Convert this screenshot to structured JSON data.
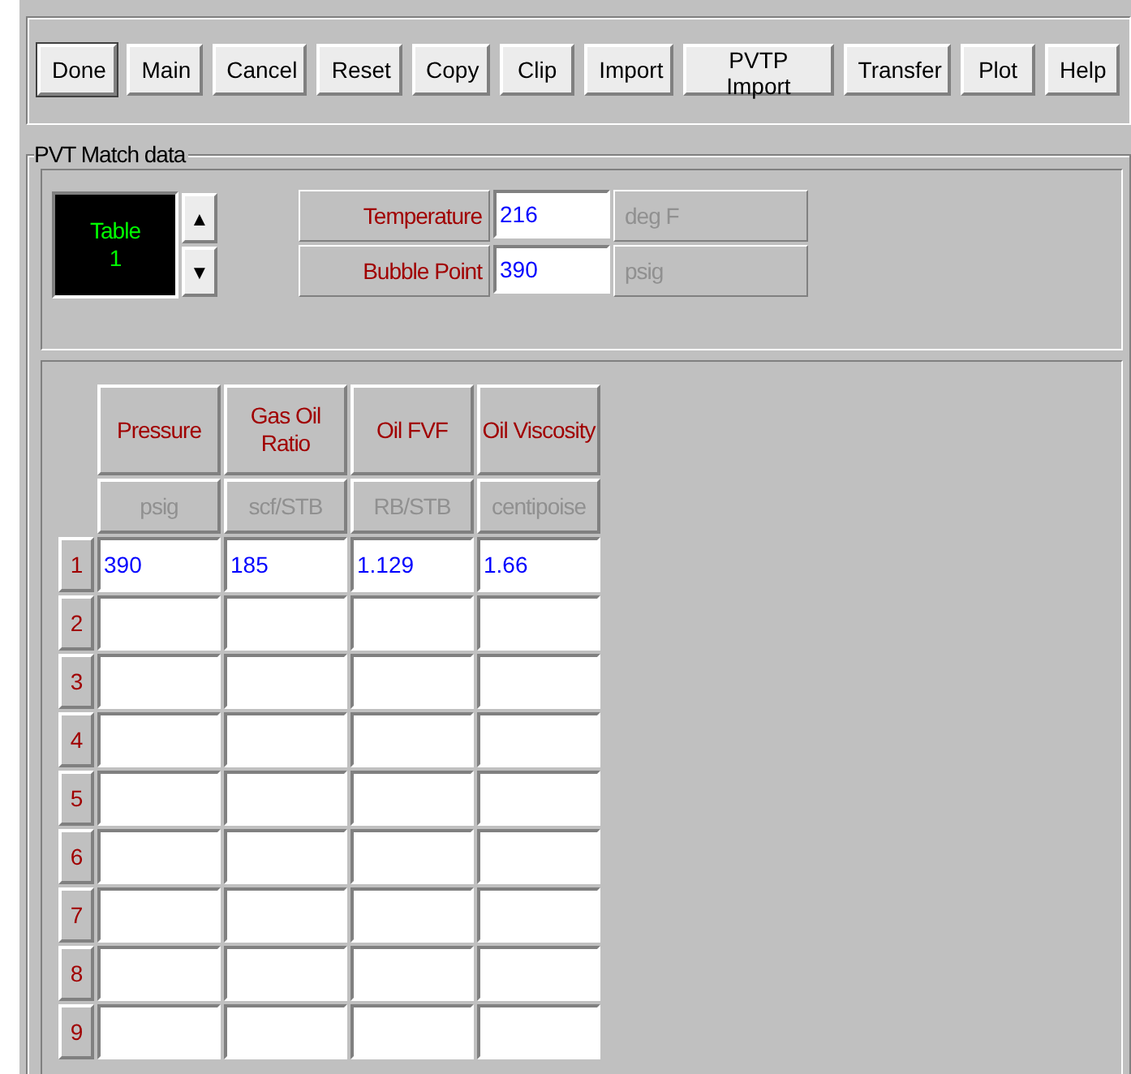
{
  "toolbar": {
    "buttons": [
      {
        "label": "Done",
        "is_default": true
      },
      {
        "label": "Main",
        "is_default": false
      },
      {
        "label": "Cancel",
        "is_default": false
      },
      {
        "label": "Reset",
        "is_default": false
      },
      {
        "label": "Copy",
        "is_default": false
      },
      {
        "label": "Clip",
        "is_default": false
      },
      {
        "label": "Import",
        "is_default": false
      },
      {
        "label": "PVTP Import",
        "is_default": false
      },
      {
        "label": "Transfer",
        "is_default": false
      },
      {
        "label": "Plot",
        "is_default": false
      },
      {
        "label": "Help",
        "is_default": false
      }
    ]
  },
  "group": {
    "title": "PVT Match data",
    "table_selector": {
      "line_1": "Table",
      "line_2": "1",
      "up": "▲",
      "down": "▼"
    },
    "fields": [
      {
        "label": "Temperature",
        "value": "216",
        "unit": "deg F"
      },
      {
        "label": "Bubble Point",
        "value": "390",
        "unit": "psig"
      }
    ],
    "table": {
      "columns": [
        {
          "name": "Pressure",
          "unit": "psig"
        },
        {
          "name": "Gas Oil Ratio",
          "unit": "scf/STB"
        },
        {
          "name": "Oil FVF",
          "unit": "RB/STB"
        },
        {
          "name": "Oil Viscosity",
          "unit": "centipoise"
        }
      ],
      "rows": [
        {
          "number": "1",
          "values": [
            "390",
            "185",
            "1.129",
            "1.66"
          ]
        },
        {
          "number": "2"
        },
        {
          "number": "3"
        },
        {
          "number": "4"
        },
        {
          "number": "5"
        },
        {
          "number": "6"
        },
        {
          "number": "7"
        },
        {
          "number": "8"
        },
        {
          "number": "9"
        }
      ]
    }
  }
}
